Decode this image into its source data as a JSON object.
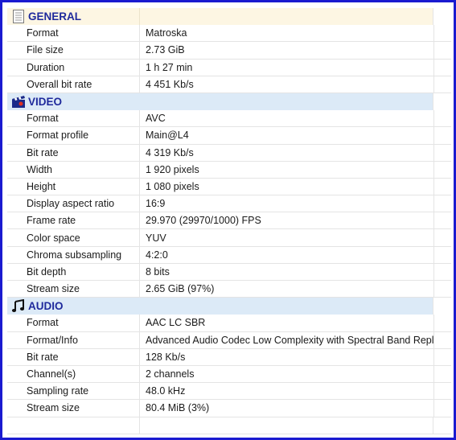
{
  "sections": {
    "general": {
      "title": "GENERAL",
      "icon": "document-icon",
      "rows": [
        {
          "label": "Format",
          "value": "Matroska"
        },
        {
          "label": "File size",
          "value": "2.73 GiB"
        },
        {
          "label": "Duration",
          "value": "1 h 27 min"
        },
        {
          "label": "Overall bit rate",
          "value": "4 451 Kb/s"
        }
      ]
    },
    "video": {
      "title": "VIDEO",
      "icon": "film-clapper-icon",
      "rows": [
        {
          "label": "Format",
          "value": "AVC"
        },
        {
          "label": "Format profile",
          "value": "Main@L4"
        },
        {
          "label": "Bit rate",
          "value": "4 319 Kb/s"
        },
        {
          "label": "Width",
          "value": "1 920 pixels"
        },
        {
          "label": "Height",
          "value": "1 080 pixels"
        },
        {
          "label": "Display aspect ratio",
          "value": "16:9"
        },
        {
          "label": "Frame rate",
          "value": "29.970 (29970/1000) FPS"
        },
        {
          "label": "Color space",
          "value": "YUV"
        },
        {
          "label": "Chroma subsampling",
          "value": "4:2:0"
        },
        {
          "label": "Bit depth",
          "value": "8 bits"
        },
        {
          "label": "Stream size",
          "value": "2.65 GiB (97%)"
        }
      ]
    },
    "audio": {
      "title": "AUDIO",
      "icon": "music-note-icon",
      "rows": [
        {
          "label": "Format",
          "value": "AAC LC SBR"
        },
        {
          "label": "Format/Info",
          "value": "Advanced Audio Codec Low Complexity with Spectral Band Replication"
        },
        {
          "label": "Bit rate",
          "value": "128 Kb/s"
        },
        {
          "label": "Channel(s)",
          "value": "2 channels"
        },
        {
          "label": "Sampling rate",
          "value": "48.0 kHz"
        },
        {
          "label": "Stream size",
          "value": "80.4 MiB (3%)"
        }
      ]
    }
  },
  "colors": {
    "frame_border": "#1a1ad0",
    "general_header_bg": "#fdf6e3",
    "stream_header_bg": "#dceaf7",
    "header_text": "#1f2a9c"
  }
}
